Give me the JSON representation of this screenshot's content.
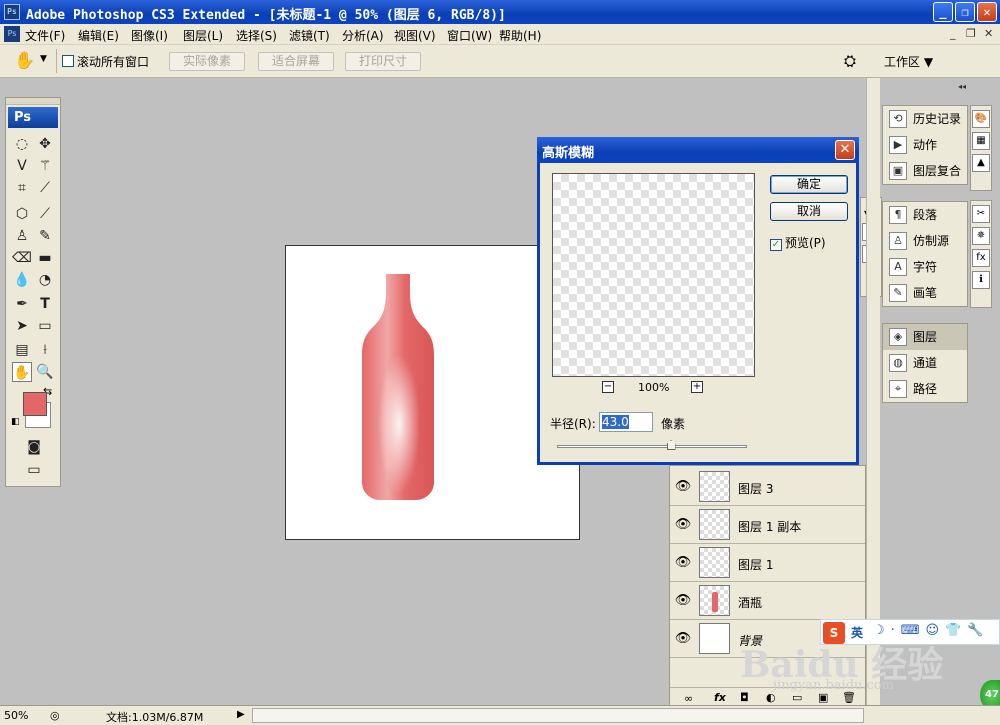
{
  "window": {
    "title": "Adobe Photoshop CS3 Extended - [未标题-1 @ 50% (图层 6, RGB/8)]",
    "app_icon": "Ps",
    "buttons": {
      "minimize": "_",
      "maximize": "❐",
      "close": "✕"
    }
  },
  "menubar": {
    "items": [
      "文件(F)",
      "编辑(E)",
      "图像(I)",
      "图层(L)",
      "选择(S)",
      "滤镜(T)",
      "分析(A)",
      "视图(V)",
      "窗口(W)",
      "帮助(H)"
    ],
    "doc_controls": [
      "_",
      "❐",
      "✕"
    ]
  },
  "options": {
    "scroll_all_label": "滚动所有窗口",
    "scroll_all_checked": false,
    "actual_pixels": "实际像素",
    "fit_screen": "适合屏幕",
    "print_size": "打印尺寸",
    "workspace": "工作区 ▼"
  },
  "toolbox": {
    "badge": "Ps",
    "fg_color": "#e46767",
    "bg_color": "#ffffff"
  },
  "dialog": {
    "title": "高斯模糊",
    "ok": "确定",
    "cancel": "取消",
    "preview_label": "预览(P)",
    "preview_checked": true,
    "zoom": "100%",
    "zoom_out": "−",
    "zoom_in": "+",
    "radius_label": "半径(R):",
    "radius_value": "43.0",
    "radius_unit": "像素",
    "radius_slider_fraction": 0.6
  },
  "dock": {
    "group1": [
      {
        "icon": "history-icon",
        "label": "历史记录"
      },
      {
        "icon": "actions-icon",
        "label": "动作"
      },
      {
        "icon": "layer-comps-icon",
        "label": "图层复合"
      }
    ],
    "group2": [
      {
        "icon": "paragraph-icon",
        "label": "段落"
      },
      {
        "icon": "clone-source-icon",
        "label": "仿制源"
      },
      {
        "icon": "character-icon",
        "label": "字符"
      },
      {
        "icon": "brushes-icon",
        "label": "画笔"
      }
    ],
    "group3": [
      {
        "icon": "layers-icon",
        "label": "图层"
      },
      {
        "icon": "channels-icon",
        "label": "通道"
      },
      {
        "icon": "paths-icon",
        "label": "路径"
      }
    ]
  },
  "layers": [
    {
      "name": "图层 3",
      "thumb": "transparent"
    },
    {
      "name": "图层 1 副本",
      "thumb": "transparent"
    },
    {
      "name": "图层 1",
      "thumb": "transparent"
    },
    {
      "name": "酒瓶",
      "thumb": "bottle"
    },
    {
      "name": "背景",
      "thumb": "white"
    }
  ],
  "layers_toolbar": [
    "∞",
    "fx",
    "◘",
    "◐",
    "▭",
    "▣",
    "🗑"
  ],
  "status": {
    "zoom": "50%",
    "doc_info": "文档:1.03M/6.87M"
  },
  "watermark": {
    "brand": "Baidu 经验",
    "url": "jingyan.baidu.com",
    "badge": "47"
  },
  "ime": {
    "logo": "S",
    "mode": "英"
  },
  "colors": {
    "titlebar": "#0a3fb6",
    "bottle": "#e46767",
    "panel": "#ece9d8",
    "workspace": "#c0c0c0"
  }
}
